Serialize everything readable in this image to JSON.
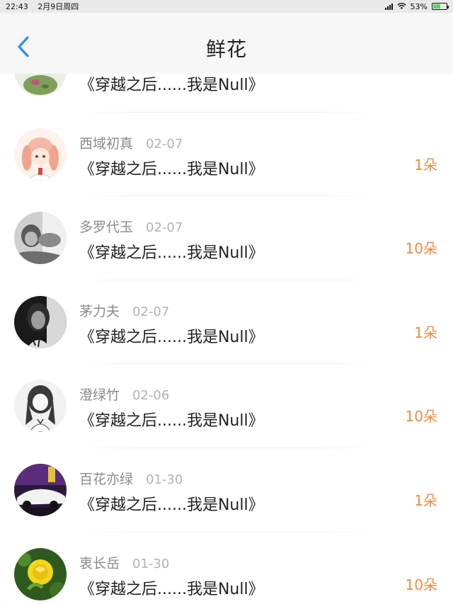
{
  "status": {
    "time": "22:43",
    "date": "2月9日周四",
    "battery_percent": "53%",
    "battery_level": 0.53,
    "icons": [
      "signal-icon",
      "wifi-icon",
      "battery-icon"
    ]
  },
  "header": {
    "title": "鲜花",
    "back_icon": "chevron-left-icon"
  },
  "accent_color": "#ef8a43",
  "back_color": "#2d8ef0",
  "items": [
    {
      "name": "",
      "date": "",
      "book": "《穿越之后......我是Null》",
      "count": ""
    },
    {
      "name": "西域初真",
      "date": "02-07",
      "book": "《穿越之后......我是Null》",
      "count": "1朵"
    },
    {
      "name": "多罗代玉",
      "date": "02-07",
      "book": "《穿越之后......我是Null》",
      "count": "10朵"
    },
    {
      "name": "茅力夫",
      "date": "02-07",
      "book": "《穿越之后......我是Null》",
      "count": "1朵"
    },
    {
      "name": "澄绿竹",
      "date": "02-06",
      "book": "《穿越之后......我是Null》",
      "count": "10朵"
    },
    {
      "name": "百花亦绿",
      "date": "01-30",
      "book": "《穿越之后......我是Null》",
      "count": "1朵"
    },
    {
      "name": "衷长岳",
      "date": "01-30",
      "book": "《穿越之后......我是Null》",
      "count": "10朵"
    }
  ]
}
